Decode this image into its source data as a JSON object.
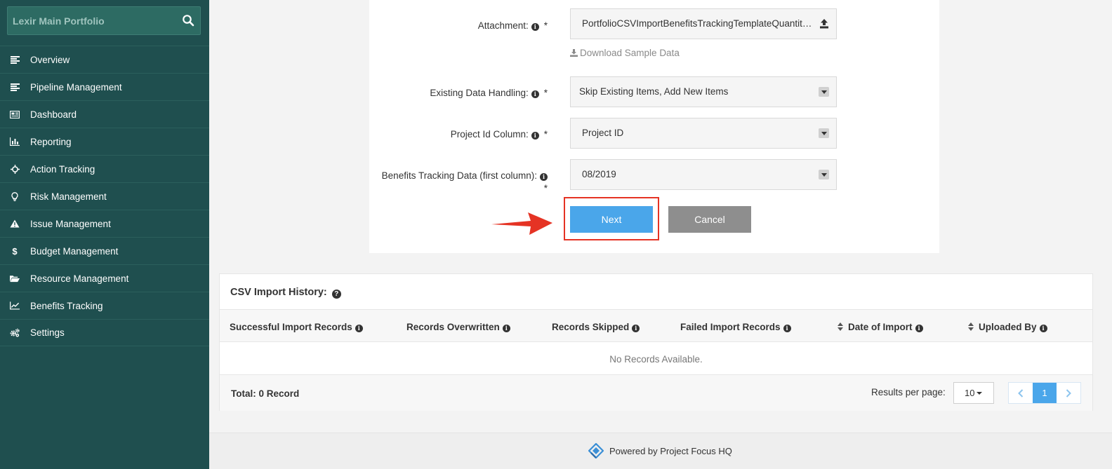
{
  "sidebar": {
    "portfolio_name": "Lexir Main Portfolio",
    "items": [
      {
        "label": "Overview",
        "icon": "list-icon"
      },
      {
        "label": "Pipeline Management",
        "icon": "list-icon"
      },
      {
        "label": "Dashboard",
        "icon": "newspaper-icon"
      },
      {
        "label": "Reporting",
        "icon": "bar-chart-icon"
      },
      {
        "label": "Action Tracking",
        "icon": "crosshair-icon"
      },
      {
        "label": "Risk Management",
        "icon": "lightbulb-icon"
      },
      {
        "label": "Issue Management",
        "icon": "warning-icon"
      },
      {
        "label": "Budget Management",
        "icon": "dollar-icon"
      },
      {
        "label": "Resource Management",
        "icon": "folder-open-icon"
      },
      {
        "label": "Benefits Tracking",
        "icon": "line-chart-icon"
      },
      {
        "label": "Settings",
        "icon": "gears-icon"
      }
    ]
  },
  "form": {
    "attachment_label": "Attachment:",
    "attachment_value": "PortfolioCSVImportBenefitsTrackingTemplateQuantitative.csv",
    "download_label": "Download Sample Data",
    "existing_label": "Existing Data Handling:",
    "existing_value": "Skip Existing Items, Add New Items",
    "project_id_label": "Project Id Column:",
    "project_id_value": "Project ID",
    "benefits_label": "Benefits Tracking Data (first column):",
    "benefits_value": "08/2019",
    "required_mark": "*",
    "next_label": "Next",
    "cancel_label": "Cancel"
  },
  "history": {
    "title": "CSV Import History:",
    "columns": [
      "Successful Import Records",
      "Records Overwritten",
      "Records Skipped",
      "Failed Import Records",
      "Date of Import",
      "Uploaded By"
    ],
    "empty_text": "No Records Available.",
    "total_text": "Total: 0 Record",
    "rpp_label": "Results per page:",
    "rpp_value": "10",
    "current_page": "1"
  },
  "footer": {
    "text": "Powered by Project Focus HQ"
  },
  "colors": {
    "sidebar": "#1f4f4f",
    "primary": "#4aa6ea",
    "highlight": "#e53324"
  }
}
